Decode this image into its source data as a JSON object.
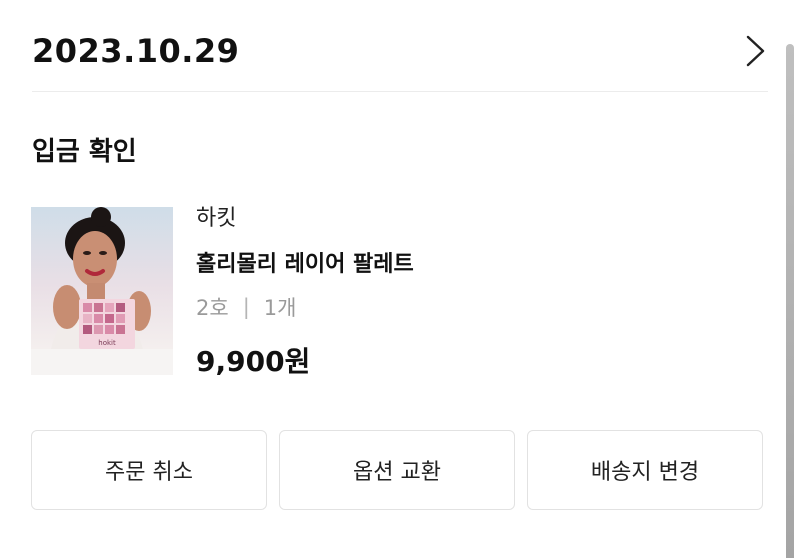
{
  "order": {
    "date": "2023.10.29",
    "status": "입금 확인"
  },
  "product": {
    "brand": "하킷",
    "name": "홀리몰리 레이어 팔레트",
    "option": "2호",
    "separator": "|",
    "quantity": "1개",
    "price": "9,900원",
    "thumbnail_text": "hokit"
  },
  "actions": {
    "cancel_label": "주문 취소",
    "exchange_label": "옵션 교환",
    "address_label": "배송지 변경"
  },
  "icons": {
    "detail": "chevron-right-icon"
  }
}
